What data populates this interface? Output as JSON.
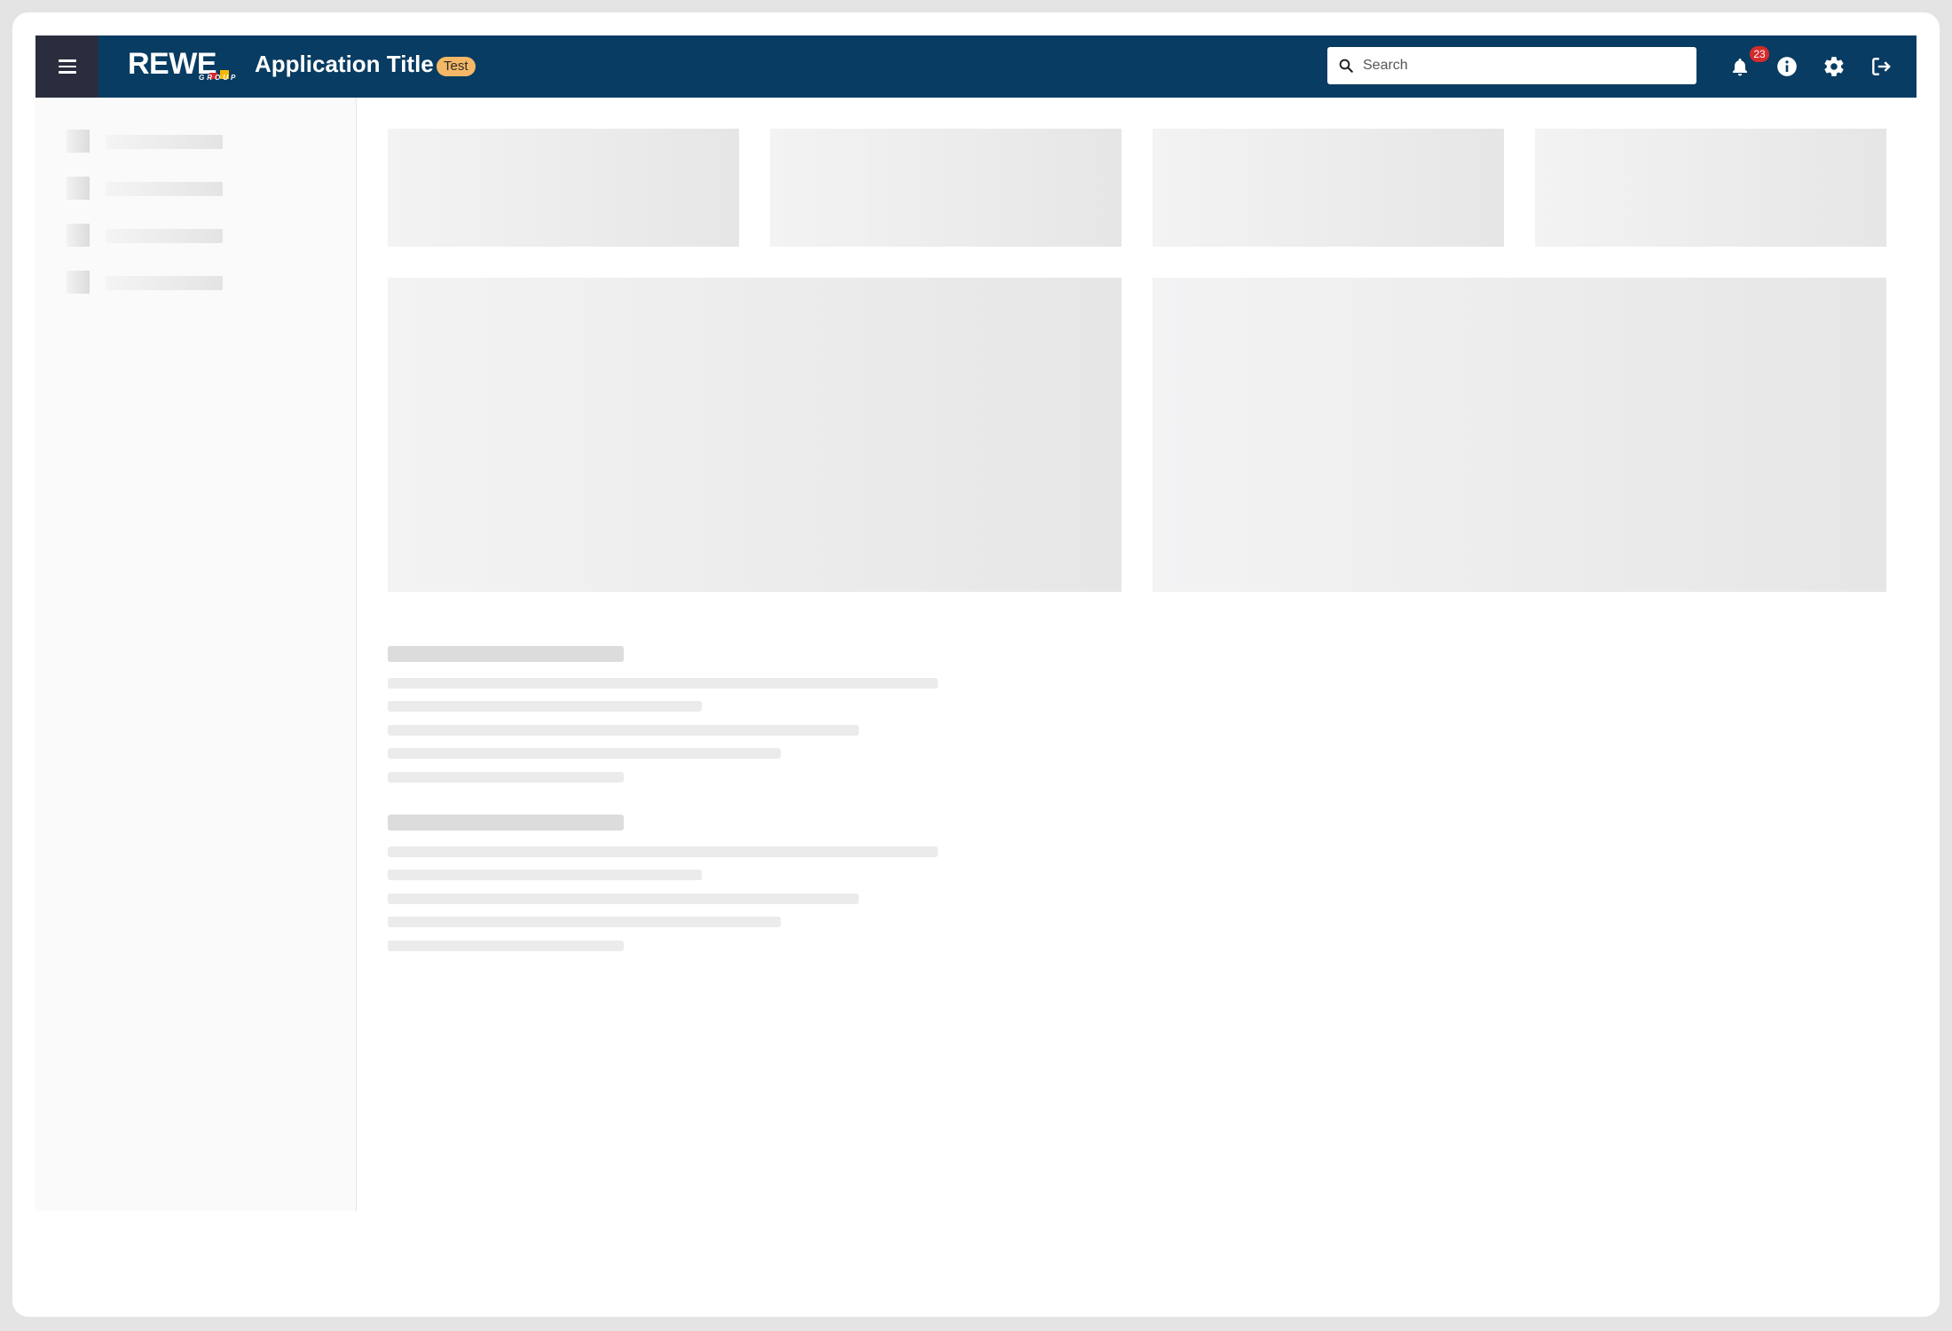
{
  "header": {
    "menu_icon": "hamburger-icon",
    "logo": {
      "word": "REWE",
      "sub": "GROUP"
    },
    "title": "Application Title",
    "environment_badge": "Test",
    "search": {
      "placeholder": "Search",
      "value": "",
      "icon": "search-icon"
    },
    "notifications": {
      "icon": "bell-icon",
      "count": "23"
    },
    "info_icon": "info-icon",
    "settings_icon": "gear-icon",
    "logout_icon": "logout-icon"
  },
  "colors": {
    "header_bg": "#083c62",
    "menu_bg": "#2a2d3e",
    "badge_bg": "#f5b866",
    "notification_bg": "#d42b2b",
    "logo_red": "#d7262c",
    "logo_yellow": "#f7b801"
  },
  "state": "loading-skeleton"
}
